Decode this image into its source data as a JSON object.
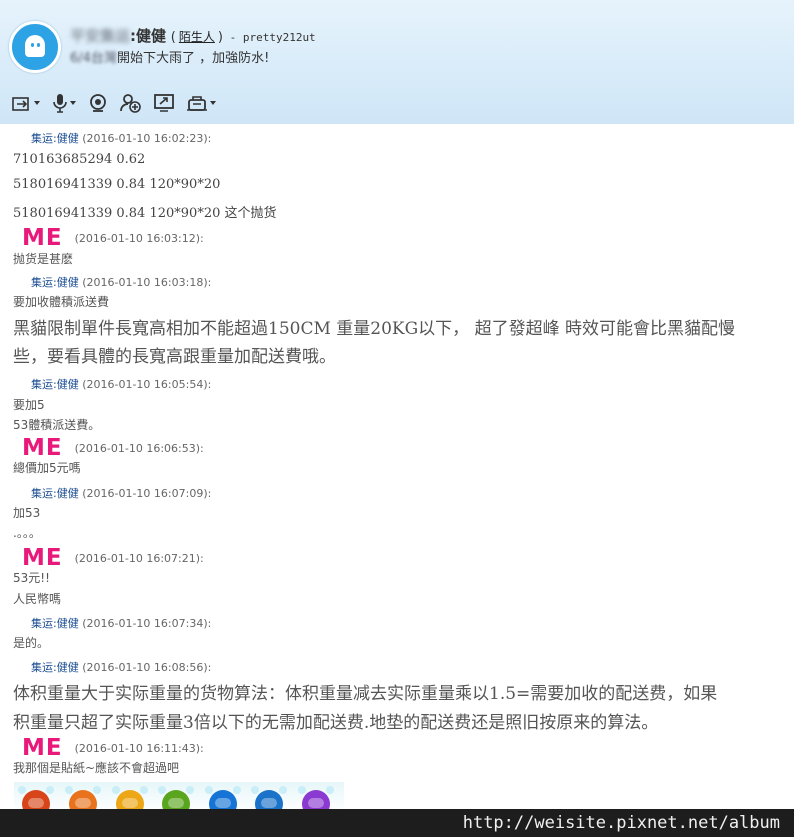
{
  "header": {
    "contact_group": "平安集运",
    "contact_name": ":健健",
    "paren_open": "(",
    "relation": "陌生人",
    "paren_close": ")",
    "account": " - pretty212ut",
    "status_blur": "6/4台灣",
    "status_text": "開始下大雨了 ，加強防水!"
  },
  "toolbar": {
    "icons": [
      "transfer-icon",
      "microphone-icon",
      "webcam-icon",
      "add-contact-icon",
      "screen-share-icon",
      "remote-assist-icon"
    ]
  },
  "chat": {
    "messages": [
      {
        "sender": "集运:健健",
        "time": " (2016-01-10 16:02:23):"
      },
      {
        "line": "710163685294  0.62"
      },
      {
        "line": "518016941339   0.84  120*90*20"
      },
      {
        "line": "518016941339  0.84 120*90*20  这个抛货"
      },
      {
        "me": "ME",
        "time": "(2016-01-10 16:03:12):"
      },
      {
        "line": "抛货是甚麽"
      },
      {
        "sender": "集运:健健",
        "time": " (2016-01-10 16:03:18):"
      },
      {
        "line": "要加收體積派送費"
      },
      {
        "big1": "黑貓限制單件長寬高相加不能超過150CM 重量20KG以下， 超了發超峰 時效可能會比黑貓配慢",
        "big2": "些，要看具體的長寬高跟重量加配送費哦。"
      },
      {
        "sender": "集运:健健",
        "time": " (2016-01-10 16:05:54):"
      },
      {
        "line": "要加5"
      },
      {
        "line": "53體積派送費。"
      },
      {
        "me": "ME",
        "time": "(2016-01-10 16:06:53):"
      },
      {
        "line": "總價加5元嗎"
      },
      {
        "sender": "集运:健健",
        "time": " (2016-01-10 16:07:09):"
      },
      {
        "line": "加53"
      },
      {
        "line": ".。。。"
      },
      {
        "me": "ME",
        "time": "(2016-01-10 16:07:21):"
      },
      {
        "line": "53元!!"
      },
      {
        "line": "人民幣嗎"
      },
      {
        "sender": "集运:健健",
        "time": " (2016-01-10 16:07:34):"
      },
      {
        "line": "是的。"
      },
      {
        "sender": "集运:健健",
        "time": " (2016-01-10 16:08:56):"
      },
      {
        "big1": " 体积重量大于实际重量的货物算法：体积重量减去实际重量乘以1.5=需要加收的配送费，如果",
        "big2": "积重量只超了实际重量3倍以下的无需加配送费.地垫的配送费还是照旧按原来的算法。"
      },
      {
        "me": "ME",
        "time": "(2016-01-10 16:11:43):"
      },
      {
        "line": "我那個是貼紙~應該不會超過吧"
      }
    ]
  },
  "emoji_colors": [
    "#d9451a",
    "#e8731c",
    "#eda716",
    "#5aa51e",
    "#1674d6",
    "#1b72c9",
    "#8a3ad1"
  ],
  "watermark": "http://weisite.pixnet.net/album"
}
